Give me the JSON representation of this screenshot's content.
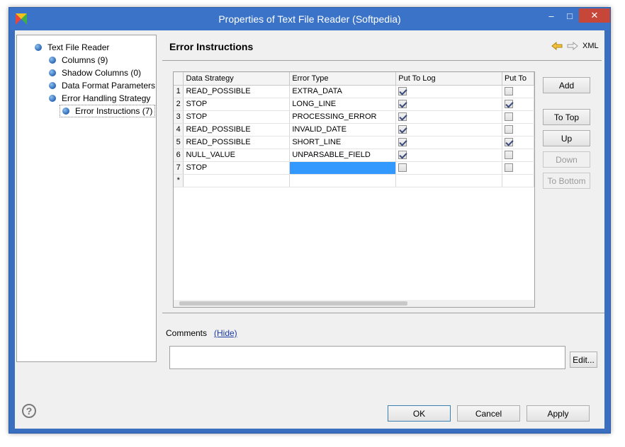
{
  "window": {
    "title": "Properties of Text File Reader (Softpedia)",
    "minimize": "–",
    "maximize": "□",
    "close": "✕"
  },
  "tree": {
    "root": "Text File Reader",
    "items": [
      {
        "label": "Columns (9)"
      },
      {
        "label": "Shadow Columns (0)"
      },
      {
        "label": "Data Format Parameters"
      },
      {
        "label": "Error Handling Strategy"
      },
      {
        "label": "Error Instructions (7)"
      }
    ]
  },
  "panel": {
    "title": "Error Instructions",
    "xml_label": "XML"
  },
  "table": {
    "columns": [
      "Data Strategy",
      "Error Type",
      "Put To Log",
      "Put To"
    ],
    "rows": [
      {
        "num": "1",
        "strategy": "READ_POSSIBLE",
        "error": "EXTRA_DATA",
        "log": true,
        "put": false
      },
      {
        "num": "2",
        "strategy": "STOP",
        "error": "LONG_LINE",
        "log": true,
        "put": true
      },
      {
        "num": "3",
        "strategy": "STOP",
        "error": "PROCESSING_ERROR",
        "log": true,
        "put": false
      },
      {
        "num": "4",
        "strategy": "READ_POSSIBLE",
        "error": "INVALID_DATE",
        "log": true,
        "put": false
      },
      {
        "num": "5",
        "strategy": "READ_POSSIBLE",
        "error": "SHORT_LINE",
        "log": true,
        "put": true
      },
      {
        "num": "6",
        "strategy": "NULL_VALUE",
        "error": "UNPARSABLE_FIELD",
        "log": true,
        "put": false
      },
      {
        "num": "7",
        "strategy": "STOP",
        "error": "",
        "log": false,
        "put": false
      }
    ],
    "new_row_marker": "*"
  },
  "buttons": {
    "add": "Add",
    "to_top": "To Top",
    "up": "Up",
    "down": "Down",
    "to_bottom": "To Bottom",
    "edit": "Edit...",
    "ok": "OK",
    "cancel": "Cancel",
    "apply": "Apply"
  },
  "comments": {
    "label": "Comments",
    "hide": "(Hide)"
  },
  "help": "?",
  "colors": {
    "title_bar": "#3b73c8",
    "close_button": "#c7463a",
    "selection": "#3399ff",
    "link": "#1a3aa0"
  }
}
